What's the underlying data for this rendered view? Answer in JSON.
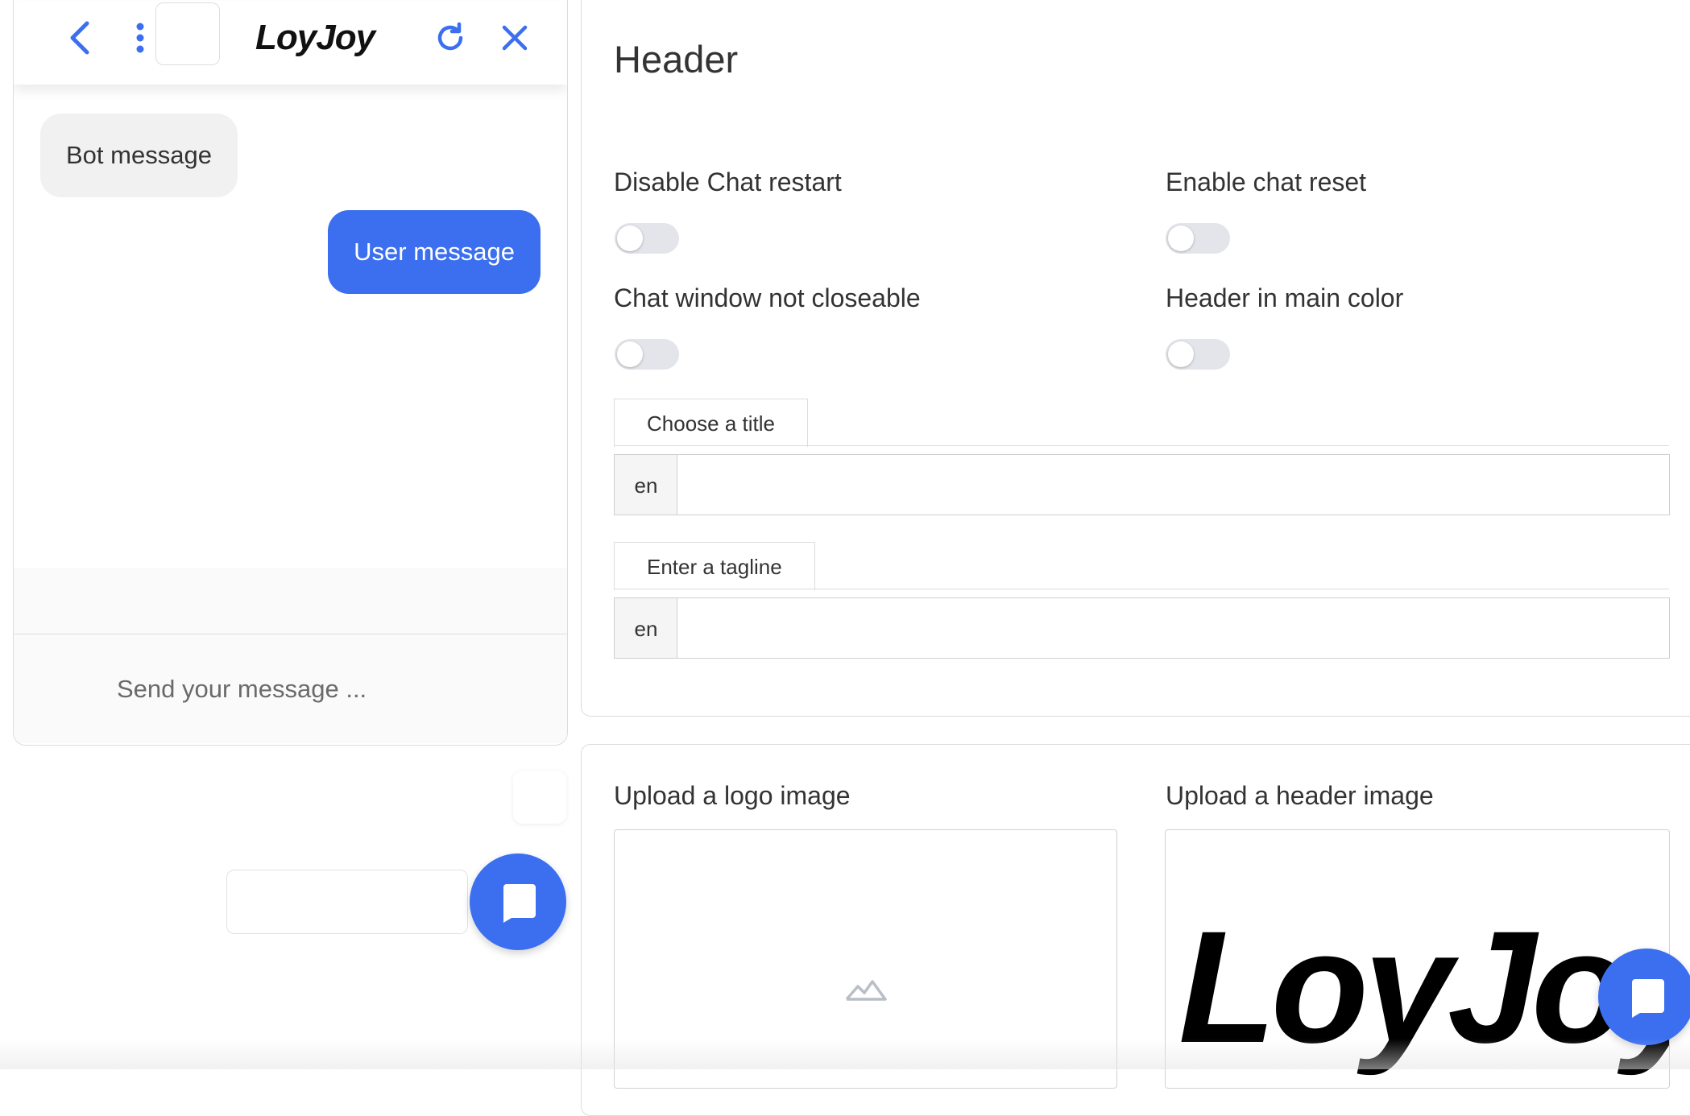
{
  "chat_preview": {
    "brand": "LoyJoy",
    "bot_message": "Bot message",
    "user_message": "User message",
    "input_placeholder": "Send your message ...",
    "accent_color": "#3b6ff0",
    "icons": {
      "back": "chevron-left-icon",
      "menu": "more-vertical-icon",
      "restart": "refresh-icon",
      "close": "close-icon",
      "launcher": "chat-bubble-icon"
    }
  },
  "settings": {
    "section_title": "Header",
    "toggles": [
      {
        "label": "Disable Chat restart",
        "on": false
      },
      {
        "label": "Enable chat reset",
        "on": false
      },
      {
        "label": "Chat window not closeable",
        "on": false
      },
      {
        "label": "Header in main color",
        "on": false
      }
    ],
    "title_field": {
      "tab_label": "Choose a title",
      "lang": "en",
      "value": ""
    },
    "tagline_field": {
      "tab_label": "Enter a tagline",
      "lang": "en",
      "value": ""
    },
    "uploads": {
      "logo_label": "Upload a logo image",
      "header_label": "Upload a header image",
      "header_image_text": "LoyJoy"
    }
  }
}
